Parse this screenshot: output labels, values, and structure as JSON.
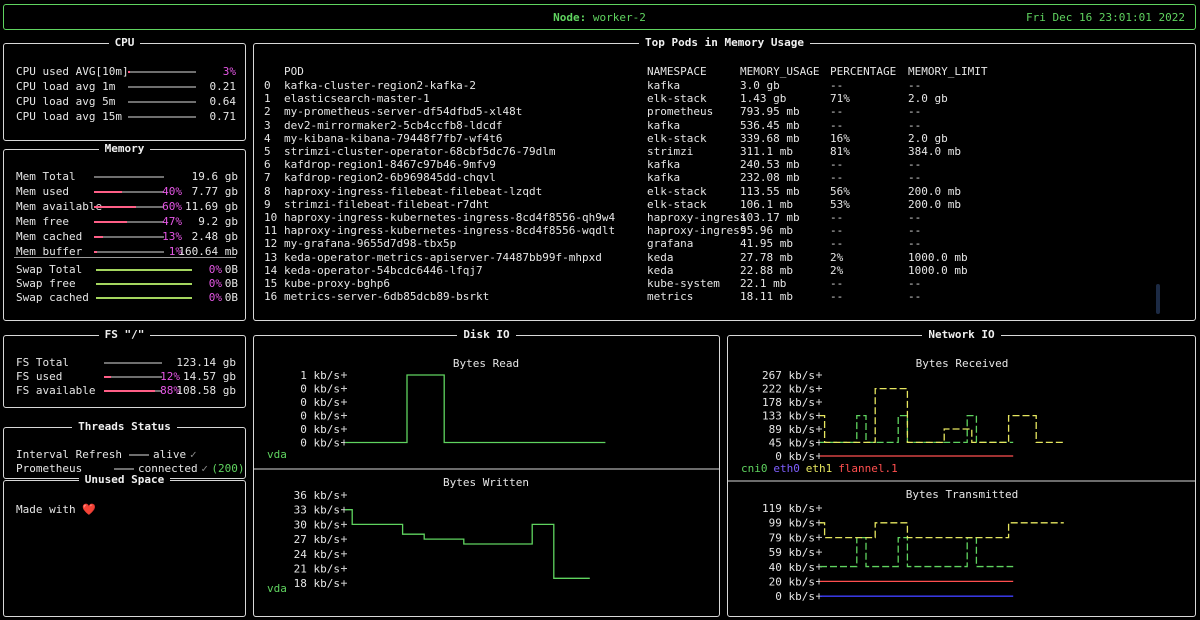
{
  "header": {
    "node_label": "Node:",
    "node_name": "worker-2",
    "datetime": "Fri Dec 16 23:01:01 2022"
  },
  "cpu": {
    "title": "CPU",
    "rows": [
      {
        "label": "CPU used AVG[10m]",
        "value": "3%",
        "level": 0.03
      },
      {
        "label": "CPU load avg 1m",
        "value": "0.21"
      },
      {
        "label": "CPU load avg 5m",
        "value": "0.64"
      },
      {
        "label": "CPU load avg 15m",
        "value": "0.71"
      }
    ]
  },
  "memory": {
    "title": "Memory",
    "rows": [
      {
        "label": "Mem Total",
        "pct": "",
        "value": "19.6 gb",
        "level": 0
      },
      {
        "label": "Mem used",
        "pct": "40%",
        "value": "7.77 gb",
        "level": 0.4
      },
      {
        "label": "Mem available",
        "pct": "60%",
        "value": "11.69 gb",
        "level": 0.6
      },
      {
        "label": "Mem free",
        "pct": "47%",
        "value": "9.2 gb",
        "level": 0.47
      },
      {
        "label": "Mem cached",
        "pct": "13%",
        "value": "2.48 gb",
        "level": 0.13
      },
      {
        "label": "Mem buffer",
        "pct": "1%",
        "value": "160.64 mb",
        "level": 0.01
      }
    ],
    "swap": [
      {
        "label": "Swap Total",
        "pct": "0%",
        "value": "0B"
      },
      {
        "label": "Swap free",
        "pct": "0%",
        "value": "0B"
      },
      {
        "label": "Swap cached",
        "pct": "0%",
        "value": "0B"
      }
    ]
  },
  "pods": {
    "title": "Top Pods in Memory Usage",
    "columns": [
      "POD",
      "NAMESPACE",
      "MEMORY_USAGE",
      "PERCENTAGE",
      "MEMORY_LIMIT"
    ],
    "rows": [
      [
        "0",
        "kafka-cluster-region2-kafka-2",
        "kafka",
        "3.0 gb",
        "--",
        "--"
      ],
      [
        "1",
        "elasticsearch-master-1",
        "elk-stack",
        "1.43 gb",
        "71%",
        "2.0 gb"
      ],
      [
        "2",
        "my-prometheus-server-df54dfbd5-xl48t",
        "prometheus",
        "793.95 mb",
        "--",
        "--"
      ],
      [
        "3",
        "dev2-mirrormaker2-5cb4ccfb8-ldcdf",
        "kafka",
        "536.45 mb",
        "--",
        "--"
      ],
      [
        "4",
        "my-kibana-kibana-79448f7fb7-wf4t6",
        "elk-stack",
        "339.68 mb",
        "16%",
        "2.0 gb"
      ],
      [
        "5",
        "strimzi-cluster-operator-68cbf5dc76-79dlm",
        "strimzi",
        "311.1 mb",
        "81%",
        "384.0 mb"
      ],
      [
        "6",
        "kafdrop-region1-8467c97b46-9mfv9",
        "kafka",
        "240.53 mb",
        "--",
        "--"
      ],
      [
        "7",
        "kafdrop-region2-6b969845dd-chqvl",
        "kafka",
        "232.08 mb",
        "--",
        "--"
      ],
      [
        "8",
        "haproxy-ingress-filebeat-filebeat-lzqdt",
        "elk-stack",
        "113.55 mb",
        "56%",
        "200.0 mb"
      ],
      [
        "9",
        "strimzi-filebeat-filebeat-r7dht",
        "elk-stack",
        "106.1 mb",
        "53%",
        "200.0 mb"
      ],
      [
        "10",
        "haproxy-ingress-kubernetes-ingress-8cd4f8556-qh9w4",
        "haproxy-ingress",
        "103.17 mb",
        "--",
        "--"
      ],
      [
        "11",
        "haproxy-ingress-kubernetes-ingress-8cd4f8556-wqdlt",
        "haproxy-ingress",
        "95.96 mb",
        "--",
        "--"
      ],
      [
        "12",
        "my-grafana-9655d7d98-tbx5p",
        "grafana",
        "41.95 mb",
        "--",
        "--"
      ],
      [
        "13",
        "keda-operator-metrics-apiserver-74487bb99f-mhpxd",
        "keda",
        "27.78 mb",
        "2%",
        "1000.0 mb"
      ],
      [
        "14",
        "keda-operator-54bcdc6446-lfqj7",
        "keda",
        "22.88 mb",
        "2%",
        "1000.0 mb"
      ],
      [
        "15",
        "kube-proxy-bghp6",
        "kube-system",
        "22.1 mb",
        "--",
        "--"
      ],
      [
        "16",
        "metrics-server-6db85dcb89-bsrkt",
        "metrics",
        "18.11 mb",
        "--",
        "--"
      ]
    ]
  },
  "fs": {
    "title": "FS \"/\"",
    "rows": [
      {
        "label": "FS Total",
        "pct": "",
        "value": "123.14 gb",
        "level": 0
      },
      {
        "label": "FS used",
        "pct": "12%",
        "value": "14.57 gb",
        "level": 0.12
      },
      {
        "label": "FS available",
        "pct": "88%",
        "value": "108.58 gb",
        "level": 0.88
      }
    ]
  },
  "threads": {
    "title": "Threads Status",
    "rows": [
      {
        "label": "Interval Refresh",
        "status": "alive",
        "check": "✓",
        "extra": ""
      },
      {
        "label": "Prometheus",
        "status": "connected",
        "check": "✓",
        "extra": "(200)"
      }
    ]
  },
  "unused": {
    "title": "Unused Space",
    "text": "Made with",
    "heart": "❤️"
  },
  "disk": {
    "title": "Disk IO",
    "device": "vda",
    "read": {
      "title": "Bytes Read",
      "y_ticks": [
        "1 kb/s",
        "0 kb/s",
        "0 kb/s",
        "0 kb/s",
        "0 kb/s",
        "0 kb/s"
      ],
      "ylim": [
        0,
        1
      ],
      "color": "#5fd35f",
      "values": [
        0,
        0,
        0,
        0,
        0,
        0,
        0,
        0,
        0,
        0,
        1,
        1,
        1,
        1,
        1,
        1,
        0,
        0,
        0,
        0,
        0,
        0,
        0,
        0,
        0,
        0,
        0,
        0,
        0,
        0,
        0,
        0,
        0,
        0,
        0,
        0,
        0,
        0,
        0,
        0,
        0,
        0
      ]
    },
    "written": {
      "title": "Bytes Written",
      "y_ticks": [
        "36 kb/s",
        "33 kb/s",
        "30 kb/s",
        "27 kb/s",
        "24 kb/s",
        "21 kb/s",
        "18 kb/s"
      ],
      "ylim": [
        18,
        36
      ],
      "color": "#5fd35f",
      "values": [
        33,
        33,
        30,
        30,
        30,
        30,
        30,
        30,
        30,
        30,
        30,
        30,
        30,
        30,
        30,
        30,
        28,
        28,
        28,
        28,
        28,
        28,
        27,
        27,
        27,
        27,
        27,
        27,
        27,
        27,
        27,
        27,
        27,
        26,
        26,
        26,
        26,
        26,
        26,
        26,
        26,
        26,
        26,
        26,
        26,
        26,
        26,
        26,
        26,
        26,
        26,
        26,
        30,
        30,
        30,
        30,
        30,
        30,
        19,
        19,
        19,
        19,
        19,
        19,
        19,
        19,
        19,
        19
      ]
    }
  },
  "network": {
    "title": "Network IO",
    "legend": [
      {
        "name": "cni0",
        "color": "#5fd35f"
      },
      {
        "name": "eth0",
        "color": "#7f5fff"
      },
      {
        "name": "eth1",
        "color": "#e6e65f"
      },
      {
        "name": "flannel.1",
        "color": "#ff4f4f"
      }
    ],
    "received": {
      "title": "Bytes Received",
      "y_ticks": [
        "267 kb/s",
        "222 kb/s",
        "178 kb/s",
        "133 kb/s",
        "89 kb/s",
        "45 kb/s",
        "0 kb/s"
      ],
      "ylim": [
        0,
        267
      ],
      "series": [
        {
          "name": "cni0",
          "color": "#5fd35f",
          "values": [
            45,
            45,
            45,
            45,
            45,
            45,
            45,
            45,
            133,
            133,
            45,
            45,
            45,
            45,
            45,
            45,
            45,
            133,
            133,
            45,
            45,
            45,
            45,
            45,
            45,
            45,
            45,
            45,
            45,
            45,
            45,
            45,
            133,
            133,
            45,
            45,
            45,
            45,
            45,
            45,
            45,
            45
          ]
        },
        {
          "name": "eth1",
          "color": "#e6e65f",
          "values": [
            133,
            45,
            45,
            45,
            45,
            45,
            45,
            45,
            45,
            45,
            45,
            45,
            222,
            222,
            222,
            222,
            222,
            222,
            222,
            45,
            45,
            45,
            45,
            45,
            45,
            45,
            45,
            89,
            89,
            89,
            89,
            89,
            89,
            45,
            45,
            45,
            45,
            45,
            45,
            45,
            45,
            133,
            133,
            133,
            133,
            133,
            133,
            45,
            45,
            45,
            45,
            45,
            45
          ]
        },
        {
          "name": "flannel.1",
          "color": "#ff4f4f",
          "values": [
            0,
            0,
            0,
            0,
            0,
            0,
            0,
            0,
            0,
            0,
            0,
            0,
            0,
            0,
            0,
            0,
            0,
            0,
            0,
            0,
            0,
            0,
            0,
            0,
            0,
            0,
            0,
            0,
            0,
            0,
            0,
            0,
            0,
            0,
            0,
            0,
            0,
            0,
            0,
            0,
            0,
            0
          ]
        }
      ]
    },
    "transmitted": {
      "title": "Bytes Transmitted",
      "y_ticks": [
        "119 kb/s",
        "99 kb/s",
        "79 kb/s",
        "59 kb/s",
        "40 kb/s",
        "20 kb/s",
        "0 kb/s"
      ],
      "ylim": [
        0,
        119
      ],
      "series": [
        {
          "name": "cni0",
          "color": "#5fd35f",
          "values": [
            40,
            40,
            40,
            40,
            40,
            40,
            40,
            40,
            79,
            79,
            40,
            40,
            40,
            40,
            40,
            40,
            40,
            79,
            79,
            40,
            40,
            40,
            40,
            40,
            40,
            40,
            40,
            40,
            40,
            40,
            40,
            40,
            79,
            79,
            40,
            40,
            40,
            40,
            40,
            40,
            40,
            40
          ]
        },
        {
          "name": "eth1",
          "color": "#e6e65f",
          "values": [
            99,
            79,
            79,
            79,
            79,
            79,
            79,
            79,
            79,
            79,
            79,
            79,
            99,
            99,
            99,
            99,
            99,
            99,
            99,
            79,
            79,
            79,
            79,
            79,
            79,
            79,
            79,
            79,
            79,
            79,
            79,
            79,
            79,
            79,
            79,
            79,
            79,
            79,
            79,
            79,
            79,
            99,
            99,
            99,
            99,
            99,
            99,
            99,
            99,
            99,
            99,
            99,
            99
          ]
        },
        {
          "name": "flannel.1",
          "color": "#ff4f4f",
          "values": [
            20,
            20,
            20,
            20,
            20,
            20,
            20,
            20,
            20,
            20,
            20,
            20,
            20,
            20,
            20,
            20,
            20,
            20,
            20,
            20,
            20,
            20,
            20,
            20,
            20,
            20,
            20,
            20,
            20,
            20,
            20,
            20,
            20,
            20,
            20,
            20,
            20,
            20,
            20,
            20,
            20,
            20
          ]
        },
        {
          "name": "eth0",
          "color": "#3f3fff",
          "values": [
            0,
            0,
            0,
            0,
            0,
            0,
            0,
            0,
            0,
            0,
            0,
            0,
            0,
            0,
            0,
            0,
            0,
            0,
            0,
            0,
            0,
            0,
            0,
            0,
            0,
            0,
            0,
            0,
            0,
            0,
            0,
            0,
            0,
            0,
            0,
            0,
            0,
            0,
            0,
            0,
            0,
            0
          ]
        }
      ]
    }
  }
}
